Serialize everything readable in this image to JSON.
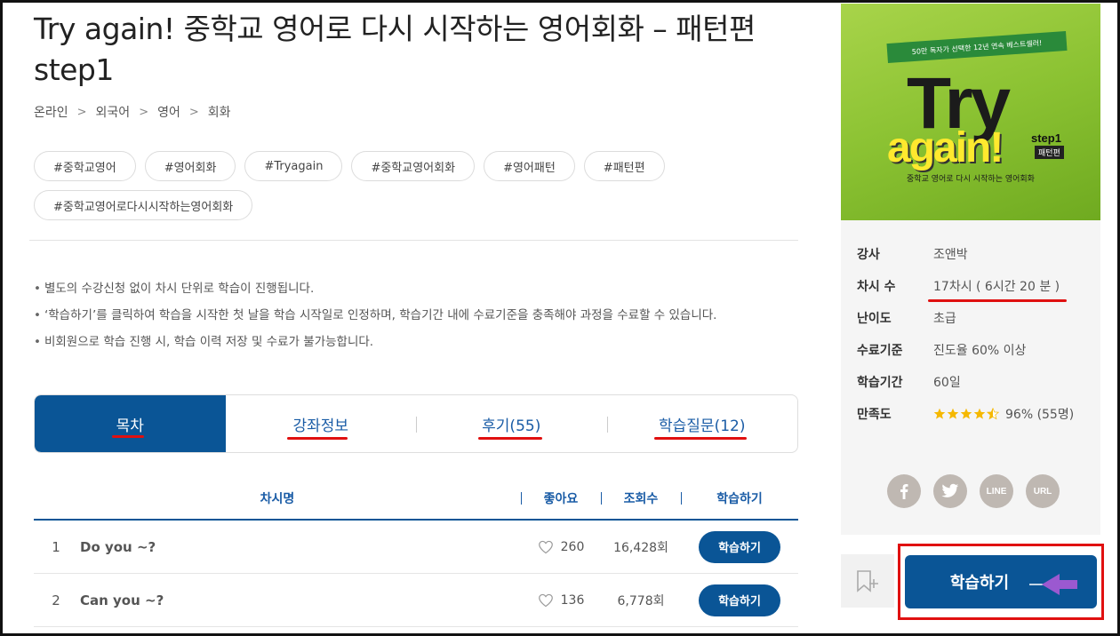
{
  "course": {
    "title": "Try again! 중학교 영어로 다시 시작하는 영어회화 – 패턴편 step1",
    "breadcrumb": [
      "온라인",
      "외국어",
      "영어",
      "회화"
    ],
    "tags": [
      "#중학교영어",
      "#영어회화",
      "#Tryagain",
      "#중학교영어회화",
      "#영어패턴",
      "#패턴편",
      "#중학교영어로다시시작하는영어회화"
    ],
    "notices": [
      "별도의 수강신청 없이 차시 단위로 학습이 진행됩니다.",
      "‘학습하기’를 클릭하여 학습을 시작한 첫 날을 학습 시작일로 인정하며, 학습기간 내에 수료기준을 충족해야 과정을 수료할 수 있습니다.",
      "비회원으로 학습 진행 시, 학습 이력 저장 및 수료가 불가능합니다."
    ]
  },
  "tabs": [
    {
      "label": "목차",
      "active": true
    },
    {
      "label": "강좌정보",
      "active": false
    },
    {
      "label": "후기(55)",
      "active": false
    },
    {
      "label": "학습질문(12)",
      "active": false
    }
  ],
  "table": {
    "headers": {
      "name": "차시명",
      "likes": "좋아요",
      "views": "조회수",
      "action": "학습하기"
    },
    "rows": [
      {
        "no": "1",
        "name": "Do you ~?",
        "likes": "260",
        "views": "16,428회",
        "action": "학습하기"
      },
      {
        "no": "2",
        "name": "Can you ~?",
        "likes": "136",
        "views": "6,778회",
        "action": "학습하기"
      }
    ]
  },
  "cover": {
    "ribbon": "50만 독자가 선택한 12년 연속 베스트셀러!",
    "word1": "Try",
    "word2": "again!",
    "step": "step1",
    "edition": "패턴편",
    "subtitle": "중학교 영어로 다시 시작하는 영어회화"
  },
  "info": {
    "instructor": {
      "key": "강사",
      "value": "조앤박"
    },
    "sessions": {
      "key": "차시 수",
      "value": "17차시 ( 6시간 20 분 )"
    },
    "level": {
      "key": "난이도",
      "value": "초급"
    },
    "criteria": {
      "key": "수료기준",
      "value": "진도율 60% 이상"
    },
    "period": {
      "key": "학습기간",
      "value": "60일"
    },
    "satisfaction": {
      "key": "만족도",
      "value": "96% (55명)",
      "rating": 4.5
    }
  },
  "social": {
    "line": "LINE",
    "url": "URL"
  },
  "cta": {
    "label": "학습하기"
  },
  "colors": {
    "primary": "#0a5596",
    "highlight": "#e01010",
    "arrow": "#9b59d0",
    "star": "#f5b800"
  }
}
